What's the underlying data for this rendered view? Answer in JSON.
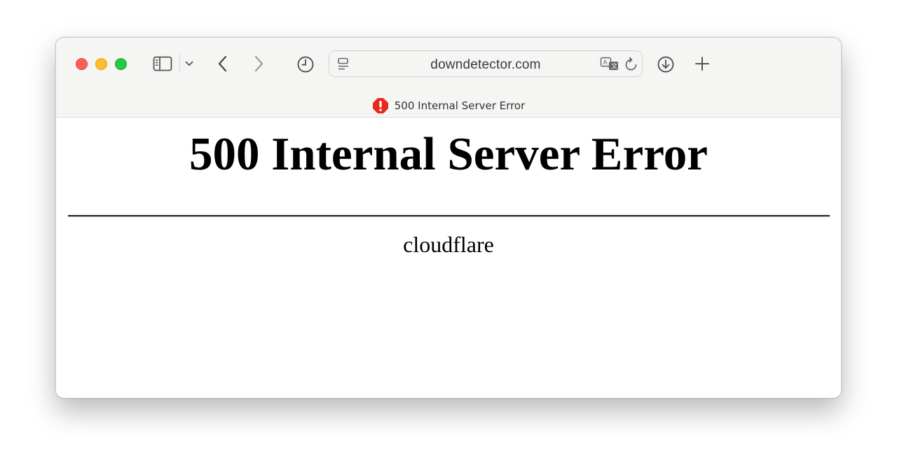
{
  "browser": {
    "address": "downdetector.com",
    "tab_title": "500 Internal Server Error"
  },
  "page": {
    "heading": "500 Internal Server Error",
    "server": "cloudflare"
  },
  "colors": {
    "close": "#fe5f57",
    "minimize": "#febc2e",
    "zoom": "#28c840",
    "error_badge": "#e8291c"
  },
  "icons": [
    "sidebar-icon",
    "chevron-down-icon",
    "back-icon",
    "forward-icon",
    "history-icon",
    "reader-icon",
    "translate-icon",
    "reload-icon",
    "downloads-icon",
    "new-tab-icon",
    "error-icon"
  ]
}
